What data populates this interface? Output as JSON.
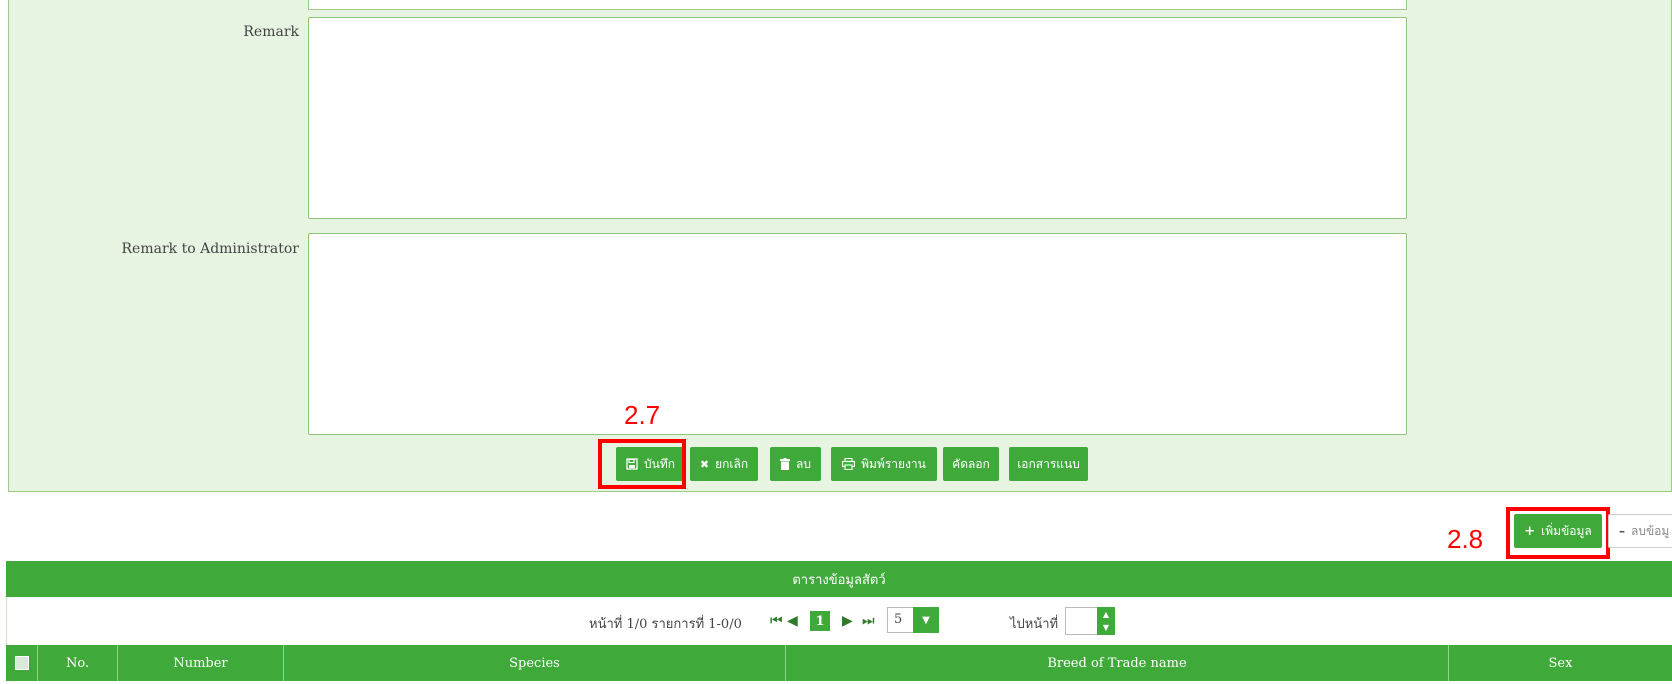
{
  "form": {
    "remark_label": "Remark",
    "remark_value": "",
    "admin_remark_label": "Remark to Administrator",
    "admin_remark_value": ""
  },
  "actions": {
    "save_label": "บันทึก",
    "cancel_label": "ยกเลิก",
    "delete_label": "ลบ",
    "print_label": "พิมพ์รายงาน",
    "copy_label": "คัดลอก",
    "attachment_label": "เอกสารแนบ"
  },
  "annotations": {
    "step_save": "2.7",
    "step_add": "2.8"
  },
  "table_actions": {
    "add_label": "เพิ่มข้อมูล",
    "delete_label": "ลบข้อมู"
  },
  "table": {
    "title": "ตารางข้อมูลสัตว์",
    "pager": {
      "summary": "หน้าที่ 1/0 รายการที่ 1-0/0",
      "current_page": "1",
      "page_size": "5",
      "goto_label": "ไปหน้าที่",
      "goto_value": ""
    },
    "columns": [
      "No.",
      "Number",
      "Species",
      "Breed of Trade name",
      "Sex"
    ]
  },
  "colors": {
    "primary_green": "#3fa93a",
    "panel_bg": "#e6f4e1",
    "annotation_red": "#ff0000"
  },
  "icons": {
    "save": "floppy-disk-icon",
    "cancel": "x-icon",
    "delete": "trash-icon",
    "print": "printer-icon",
    "add": "plus-icon",
    "remove": "minus-icon"
  }
}
